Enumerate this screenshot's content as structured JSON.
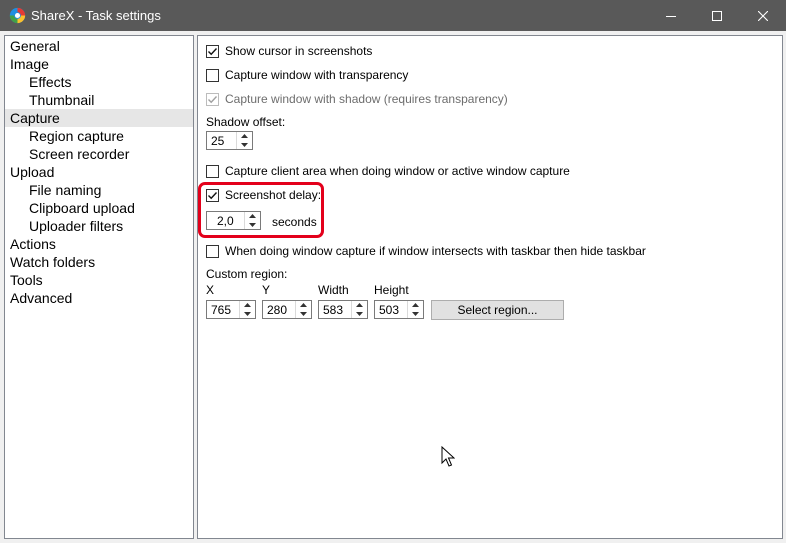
{
  "window": {
    "title": "ShareX - Task settings",
    "app_icon": "sharex-logo-icon",
    "controls": [
      "minimize-icon",
      "maximize-icon",
      "close-icon"
    ]
  },
  "sidebar": {
    "items": [
      {
        "label": "General",
        "level": 0,
        "selected": false
      },
      {
        "label": "Image",
        "level": 0,
        "selected": false
      },
      {
        "label": "Effects",
        "level": 1,
        "selected": false
      },
      {
        "label": "Thumbnail",
        "level": 1,
        "selected": false
      },
      {
        "label": "Capture",
        "level": 0,
        "selected": true
      },
      {
        "label": "Region capture",
        "level": 1,
        "selected": false
      },
      {
        "label": "Screen recorder",
        "level": 1,
        "selected": false
      },
      {
        "label": "Upload",
        "level": 0,
        "selected": false
      },
      {
        "label": "File naming",
        "level": 1,
        "selected": false
      },
      {
        "label": "Clipboard upload",
        "level": 1,
        "selected": false
      },
      {
        "label": "Uploader filters",
        "level": 1,
        "selected": false
      },
      {
        "label": "Actions",
        "level": 0,
        "selected": false
      },
      {
        "label": "Watch folders",
        "level": 0,
        "selected": false
      },
      {
        "label": "Tools",
        "level": 0,
        "selected": false
      },
      {
        "label": "Advanced",
        "level": 0,
        "selected": false
      }
    ]
  },
  "capture": {
    "show_cursor": {
      "label": "Show cursor in screenshots",
      "checked": true
    },
    "transparency": {
      "label": "Capture window with transparency",
      "checked": false
    },
    "shadow": {
      "label": "Capture window with shadow (requires transparency)",
      "checked": true,
      "enabled": false
    },
    "shadow_offset": {
      "label": "Shadow offset:",
      "value": "25"
    },
    "client_area": {
      "label": "Capture client area when doing window or active window capture",
      "checked": false
    },
    "screenshot_delay": {
      "label": "Screenshot delay:",
      "checked": true,
      "value": "2,0",
      "unit": "seconds"
    },
    "hide_taskbar": {
      "label": "When doing window capture if window intersects with taskbar then hide taskbar",
      "checked": false
    },
    "custom_region": {
      "label": "Custom region:",
      "x": {
        "label": "X",
        "value": "765"
      },
      "y": {
        "label": "Y",
        "value": "280"
      },
      "width": {
        "label": "Width",
        "value": "583"
      },
      "height": {
        "label": "Height",
        "value": "503"
      },
      "select_button": "Select region..."
    }
  },
  "annotation": {
    "highlight_color": "#e3001b"
  },
  "colors": {
    "titlebar": "#595959",
    "window_bg": "#f0f0f0",
    "selected_nav": "#e6e6e6"
  }
}
